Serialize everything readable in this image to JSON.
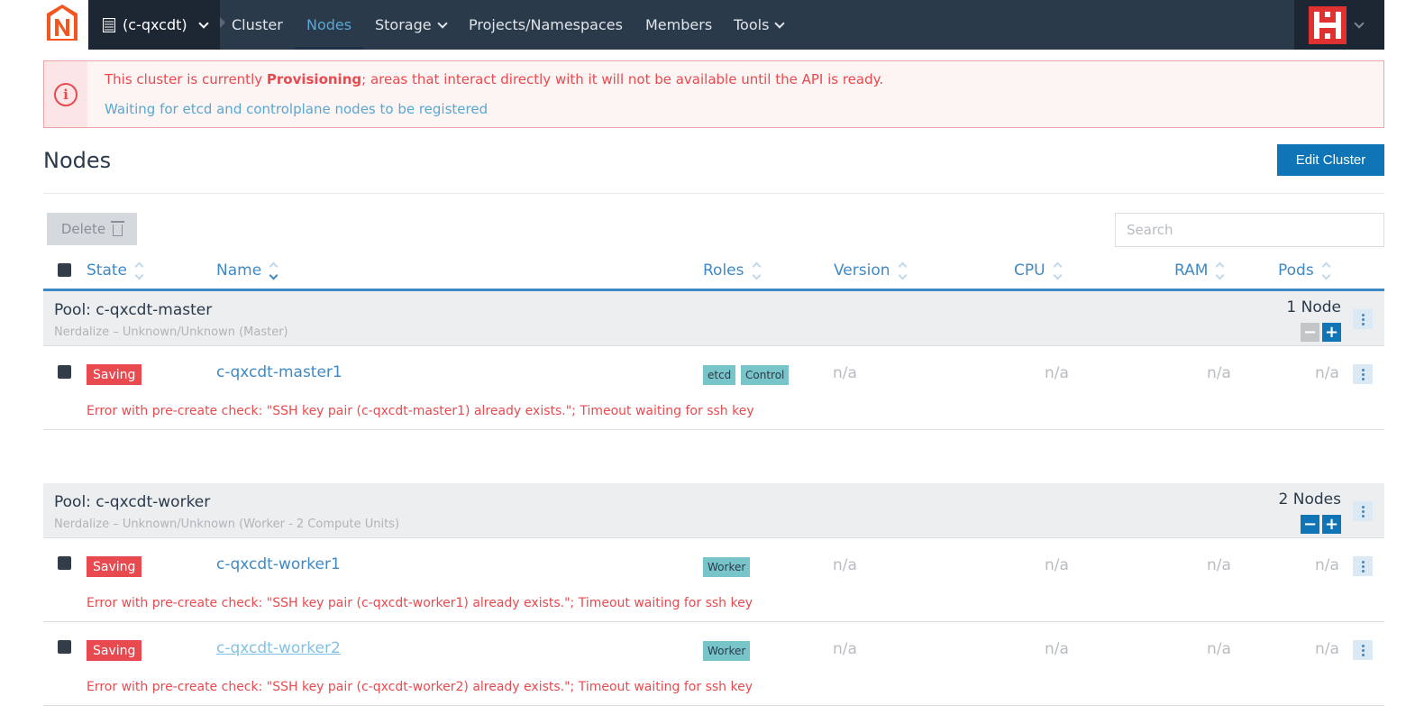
{
  "nav": {
    "cluster_label": "(c-qxcdt)",
    "items": [
      "Cluster",
      "Nodes",
      "Storage",
      "Projects/Namespaces",
      "Members",
      "Tools"
    ],
    "active": "Nodes"
  },
  "alert": {
    "line1_pre": "This cluster is currently ",
    "line1_bold": "Provisioning",
    "line1_post": "; areas that interact directly with it will not be available until the API is ready.",
    "line2": "Waiting for etcd and controlplane nodes to be registered"
  },
  "page": {
    "title": "Nodes",
    "edit_button": "Edit Cluster",
    "delete_button": "Delete",
    "search_placeholder": "Search"
  },
  "columns": [
    "State",
    "Name",
    "Roles",
    "Version",
    "CPU",
    "RAM",
    "Pods"
  ],
  "pools": [
    {
      "name": "Pool: c-qxcdt-master",
      "sub": "Nerdalize – Unknown/Unknown (Master)",
      "count": "1 Node",
      "nodes": [
        {
          "state": "Saving",
          "name": "c-qxcdt-master1",
          "roles": [
            "etcd",
            "Control"
          ],
          "version": "n/a",
          "cpu": "n/a",
          "ram": "n/a",
          "pods": "n/a",
          "error": "Error with pre-create check: \"SSH key pair (c-qxcdt-master1) already exists.\"; Timeout waiting for ssh key"
        }
      ]
    },
    {
      "name": "Pool: c-qxcdt-worker",
      "sub": "Nerdalize – Unknown/Unknown (Worker - 2 Compute Units)",
      "count": "2 Nodes",
      "nodes": [
        {
          "state": "Saving",
          "name": "c-qxcdt-worker1",
          "roles": [
            "Worker"
          ],
          "version": "n/a",
          "cpu": "n/a",
          "ram": "n/a",
          "pods": "n/a",
          "error": "Error with pre-create check: \"SSH key pair (c-qxcdt-worker1) already exists.\"; Timeout waiting for ssh key"
        },
        {
          "state": "Saving",
          "name": "c-qxcdt-worker2",
          "roles": [
            "Worker"
          ],
          "version": "n/a",
          "cpu": "n/a",
          "ram": "n/a",
          "pods": "n/a",
          "error": "Error with pre-create check: \"SSH key pair (c-qxcdt-worker2) already exists.\"; Timeout waiting for ssh key"
        }
      ]
    }
  ],
  "colors": {
    "nav_bg": "#2b3a4b",
    "accent": "#1075b6",
    "link": "#3f89c4",
    "error": "#e84a4f",
    "role_bg": "#78c5c9"
  },
  "icons": {
    "logo": "nerdalize-logo-icon",
    "alert": "info-circle-icon",
    "trash": "trash-icon",
    "avatar": "user-avatar-icon",
    "more": "kebab-menu-icon"
  }
}
